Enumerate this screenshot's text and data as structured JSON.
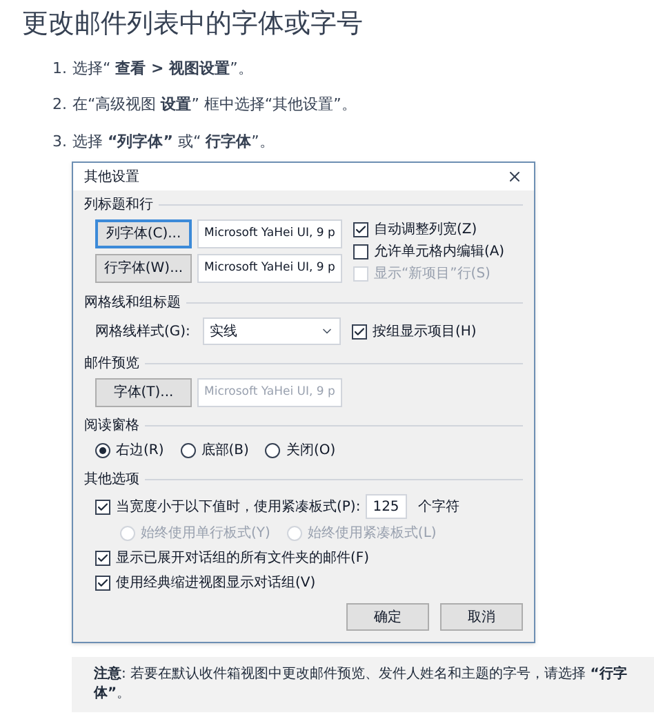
{
  "title": "更改邮件列表中的字体或字号",
  "steps": [
    {
      "number": "1.",
      "text": "选择“ **查看 > 视图设置**”。"
    },
    {
      "number": "2.",
      "text": "在“高级视图 **设置**” 框中选择“其他设置”。"
    },
    {
      "number": "3.",
      "text": "选择 **“列字体”** 或“ **行字体**”。"
    }
  ],
  "dialog": {
    "title": "其他设置",
    "columns": {
      "heading": "列标题和行",
      "font_rows": [
        {
          "button": "列字体(C)...",
          "value": "Microsoft YaHei UI, 9 p",
          "focused": true
        },
        {
          "button": "行字体(W)...",
          "value": "Microsoft YaHei UI, 9 p",
          "focused": false
        }
      ],
      "options": [
        {
          "label": "自动调整列宽(Z)",
          "checked": true,
          "disabled": false
        },
        {
          "label": "允许单元格内编辑(A)",
          "checked": false,
          "disabled": false
        },
        {
          "label": "显示“新项目”行(S)",
          "checked": false,
          "disabled": true
        }
      ]
    },
    "gridlines": {
      "heading": "网格线和组标题",
      "label": "网格线样式(G):",
      "value": "实线",
      "option": {
        "label": "按组显示项目(H)",
        "checked": true,
        "disabled": false
      }
    },
    "preview": {
      "heading": "邮件预览",
      "button": "字体(T)...",
      "value": "Microsoft YaHei UI, 9 p",
      "disabled": true
    },
    "reading_pane": {
      "heading": "阅读窗格",
      "options": [
        {
          "label": "右边(R)",
          "selected": true,
          "disabled": false
        },
        {
          "label": "底部(B)",
          "selected": false,
          "disabled": false
        },
        {
          "label": "关闭(O)",
          "selected": false,
          "disabled": false
        }
      ]
    },
    "other": {
      "heading": "其他选项",
      "compact": {
        "label": "当宽度小于以下值时，使用紧凑板式(P):",
        "checked": true,
        "disabled": false,
        "value": "125",
        "unit": "个字符",
        "sub_options": [
          {
            "label": "始终使用单行板式(Y)",
            "selected": false,
            "disabled": true
          },
          {
            "label": "始终使用紧凑板式(L)",
            "selected": false,
            "disabled": true
          }
        ]
      },
      "options": [
        {
          "label": "显示已展开对话组的所有文件夹的邮件(F)",
          "checked": true,
          "disabled": false
        },
        {
          "label": "使用经典缩进视图显示对话组(V)",
          "checked": true,
          "disabled": false
        }
      ]
    },
    "buttons": [
      "确定",
      "取消"
    ]
  },
  "note": "**注意**: 若要在默认收件箱视图中更改邮件预览、发件人姓名和主题的字号，请选择 **“行字体”**。"
}
